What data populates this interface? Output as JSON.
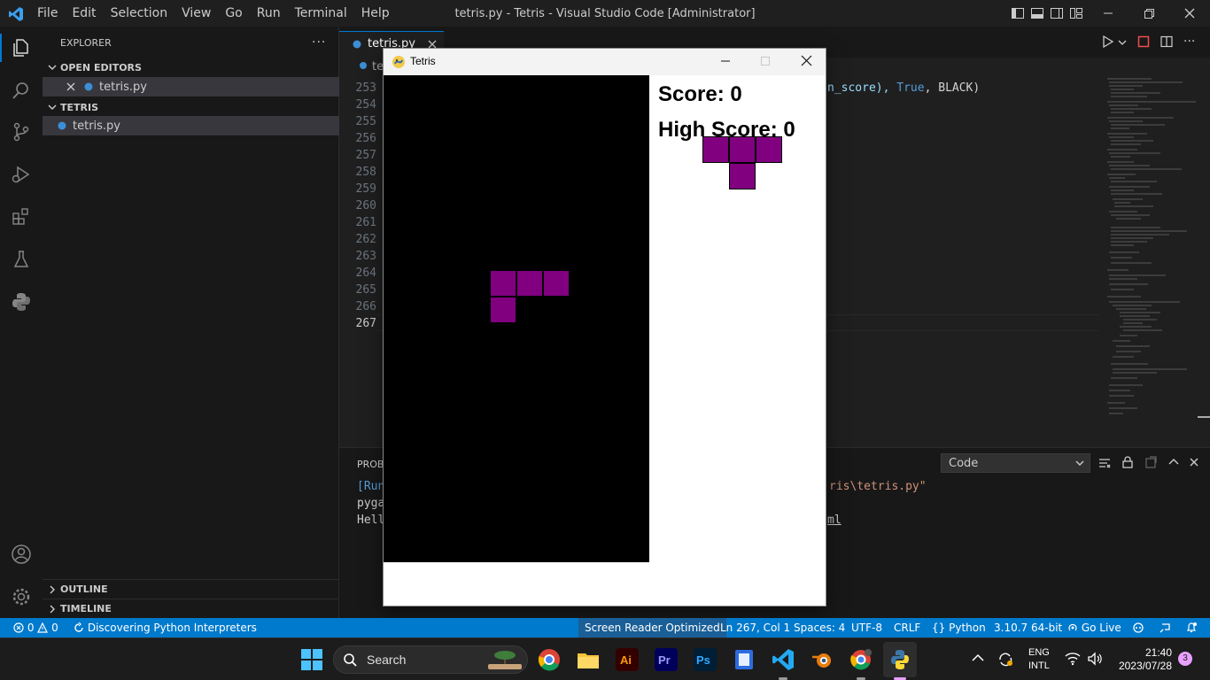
{
  "window": {
    "title": "tetris.py - Tetris - Visual Studio Code [Administrator]",
    "menu": [
      "File",
      "Edit",
      "Selection",
      "View",
      "Go",
      "Run",
      "Terminal",
      "Help"
    ]
  },
  "sidebar": {
    "header": "EXPLORER",
    "open_editors_label": "OPEN EDITORS",
    "open_editor_file": "tetris.py",
    "folder_label": "TETRIS",
    "folder_file": "tetris.py",
    "outline_label": "OUTLINE",
    "timeline_label": "TIMELINE"
  },
  "editor": {
    "tab_label": "tetris.py",
    "breadcrumb_fragment": "te",
    "line_numbers": [
      "253",
      "254",
      "255",
      "256",
      "257",
      "258",
      "259",
      "260",
      "261",
      "262",
      "263",
      "264",
      "265",
      "266",
      "267"
    ],
    "code_line_visible": {
      "part1": "n_score), ",
      "part2": "True",
      "part3": ", BLACK)"
    }
  },
  "panel": {
    "tab_fragment": "PROBL",
    "dropdown_value": "Code",
    "line1_left": "[Run",
    "line1_right": "ris\\tetris.py\"",
    "line2_left": "pyga",
    "line3_left": "Hell",
    "line3_right": "ml"
  },
  "status": {
    "errors": "0",
    "warnings": "0",
    "task": "Discovering Python Interpreters",
    "screen_reader": "Screen Reader Optimized",
    "position": "Ln 267, Col 1",
    "spaces": "Spaces: 4",
    "encoding": "UTF-8",
    "eol": "CRLF",
    "language": "Python",
    "interpreter": "3.10.7 64-bit",
    "go_live": "Go Live",
    "notifications_count": "3"
  },
  "tetris": {
    "title": "Tetris",
    "score_text": "Score: 0",
    "high_score_text": "High Score: 0",
    "piece_color": "#800080"
  },
  "taskbar": {
    "search_label": "Search",
    "lang_line1": "ENG",
    "lang_line2": "INTL",
    "time": "21:40",
    "date": "2023/07/28",
    "notification_badge": "3"
  },
  "colors": {
    "accent": "#007acc",
    "editor_bg": "#1f1f1f",
    "sidebar_bg": "#181818"
  }
}
